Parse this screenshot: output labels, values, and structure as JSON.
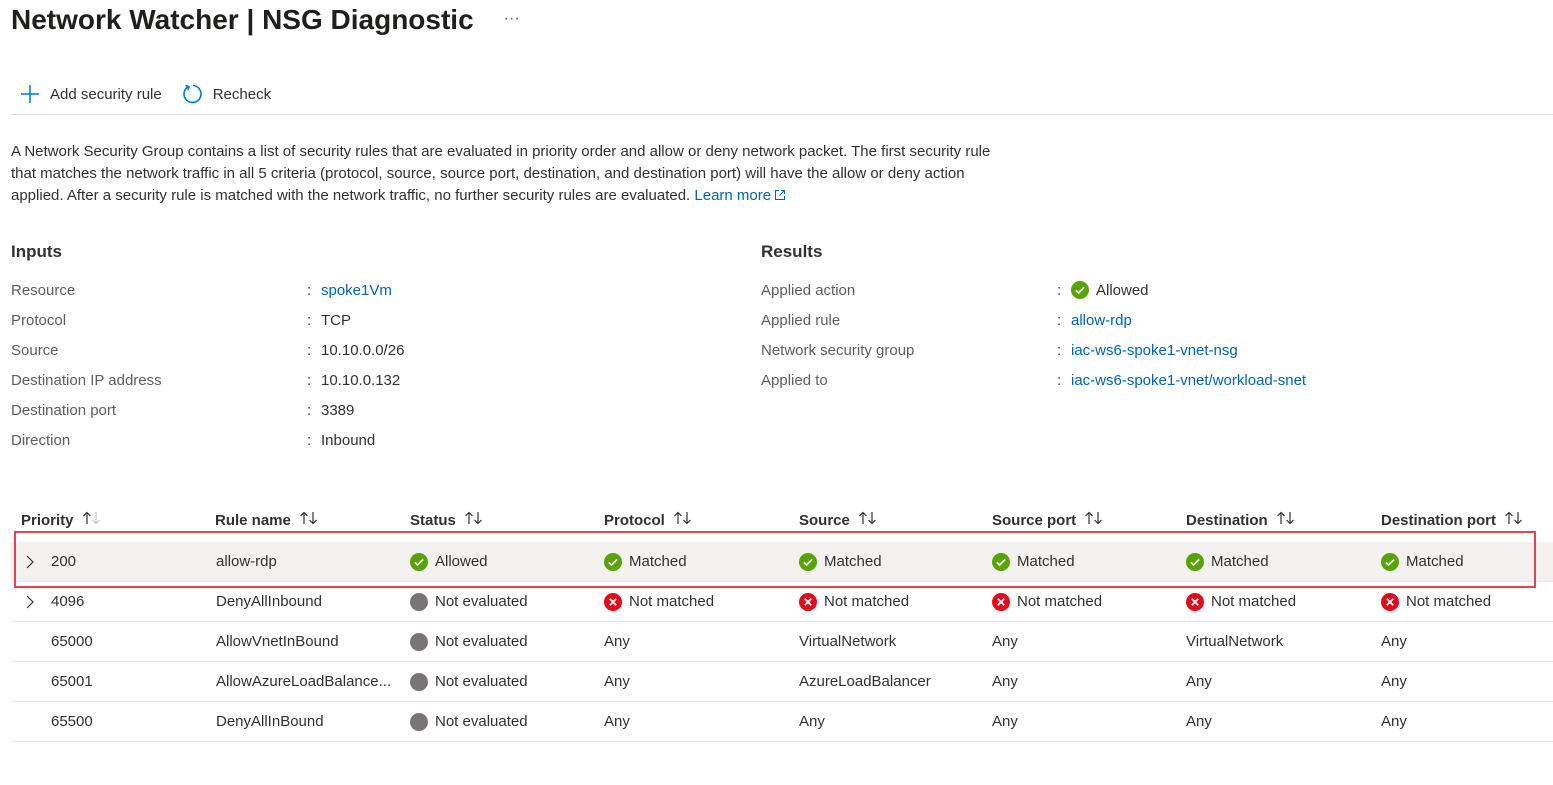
{
  "page": {
    "title": "Network Watcher | NSG Diagnostic",
    "more": "···"
  },
  "toolbar": {
    "add_label": "Add security rule",
    "recheck_label": "Recheck"
  },
  "description": {
    "text": "A Network Security Group contains a list of security rules that are evaluated in priority order and allow or deny network packet. The first security rule that matches the network traffic in all 5 criteria (protocol, source, source port, destination, and destination port) will have the allow or deny action applied. After a security rule is matched with the network traffic, no further security rules are evaluated.",
    "link": "Learn more"
  },
  "inputs": {
    "heading": "Inputs",
    "resource_label": "Resource",
    "resource_value": "spoke1Vm",
    "protocol_label": "Protocol",
    "protocol_value": "TCP",
    "source_label": "Source",
    "source_value": "10.10.0.0/26",
    "dest_ip_label": "Destination IP address",
    "dest_ip_value": "10.10.0.132",
    "dest_port_label": "Destination port",
    "dest_port_value": "3389",
    "direction_label": "Direction",
    "direction_value": "Inbound",
    "sep": ":"
  },
  "results": {
    "heading": "Results",
    "action_label": "Applied action",
    "action_value": "Allowed",
    "rule_label": "Applied rule",
    "rule_value": "allow-rdp",
    "nsg_label": "Network security group",
    "nsg_value": "iac-ws6-spoke1-vnet-nsg",
    "applied_to_label": "Applied to",
    "applied_to_value": "iac-ws6-spoke1-vnet/workload-snet",
    "sep": ":"
  },
  "table": {
    "headers": {
      "priority": "Priority",
      "rule_name": "Rule name",
      "status": "Status",
      "protocol": "Protocol",
      "source": "Source",
      "source_port": "Source port",
      "destination": "Destination",
      "destination_port": "Destination port"
    },
    "rows": [
      {
        "priority": "200",
        "rule_name": "allow-rdp",
        "status": "Allowed",
        "protocol": "Matched",
        "source": "Matched",
        "source_port": "Matched",
        "destination": "Matched",
        "destination_port": "Matched"
      },
      {
        "priority": "4096",
        "rule_name": "DenyAllInbound",
        "status": "Not evaluated",
        "protocol": "Not matched",
        "source": "Not matched",
        "source_port": "Not matched",
        "destination": "Not matched",
        "destination_port": "Not matched"
      },
      {
        "priority": "65000",
        "rule_name": "AllowVnetInBound",
        "status": "Not evaluated",
        "protocol": "Any",
        "source": "VirtualNetwork",
        "source_port": "Any",
        "destination": "VirtualNetwork",
        "destination_port": "Any"
      },
      {
        "priority": "65001",
        "rule_name": "AllowAzureLoadBalance...",
        "status": "Not evaluated",
        "protocol": "Any",
        "source": "AzureLoadBalancer",
        "source_port": "Any",
        "destination": "Any",
        "destination_port": "Any"
      },
      {
        "priority": "65500",
        "rule_name": "DenyAllInBound",
        "status": "Not evaluated",
        "protocol": "Any",
        "source": "Any",
        "source_port": "Any",
        "destination": "Any",
        "destination_port": "Any"
      }
    ]
  },
  "colors": {
    "link": "#0063b1",
    "success": "#57a300",
    "error": "#e00b1c",
    "neutral": "#7a7574",
    "highlight": "#e0464b"
  },
  "icons": {
    "add": "plus-icon",
    "recheck": "refresh-icon",
    "success": "check-circle-icon",
    "error": "error-circle-icon",
    "neutral": "gray-circle-icon",
    "expand": "chevron-right-icon",
    "sort": "sort-icon",
    "external": "external-link-icon"
  }
}
